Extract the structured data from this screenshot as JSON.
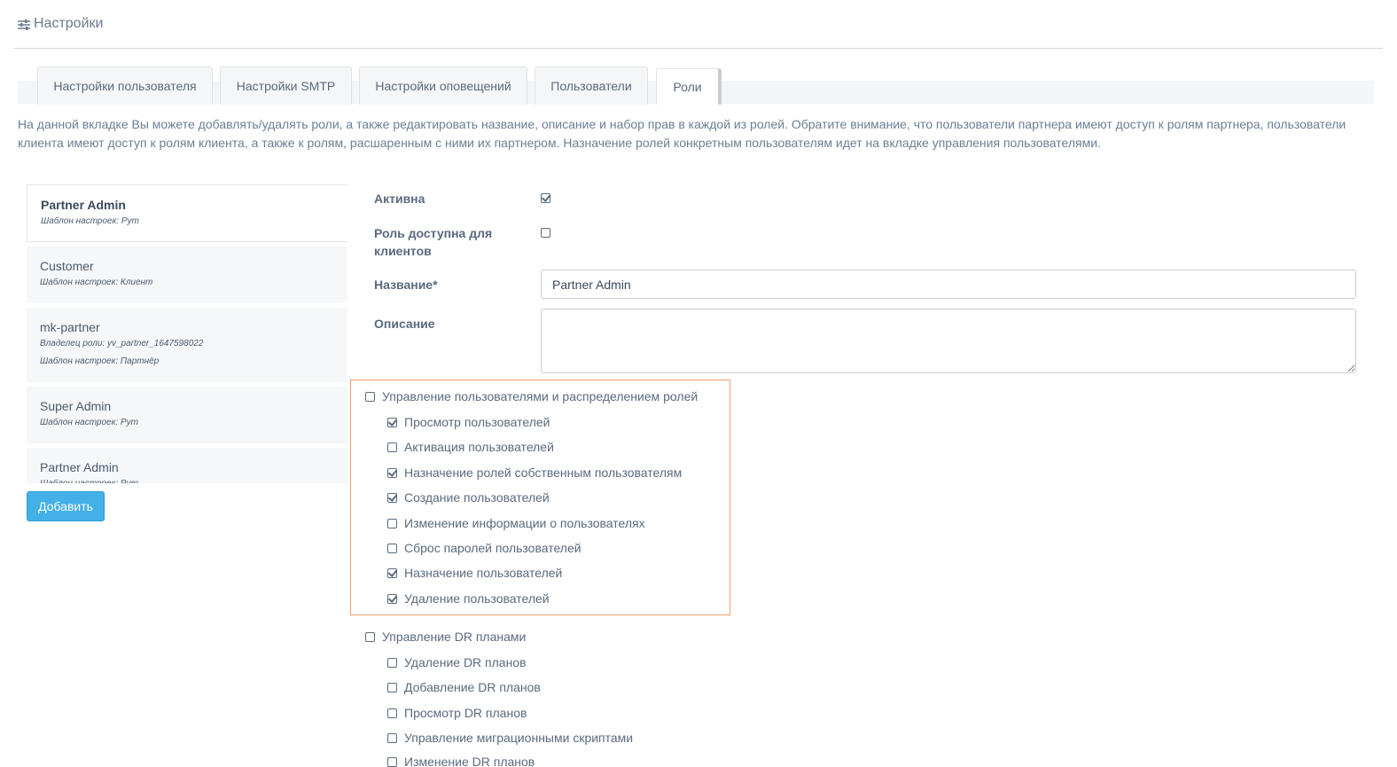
{
  "header": {
    "title": "Настройки",
    "icon": "sliders-icon"
  },
  "tabs": [
    {
      "label": "Настройки пользователя",
      "active": false
    },
    {
      "label": "Настройки SMTP",
      "active": false
    },
    {
      "label": "Настройки оповещений",
      "active": false
    },
    {
      "label": "Пользователи",
      "active": false
    },
    {
      "label": "Роли",
      "active": true
    }
  ],
  "description": "На данной вкладке Вы можете добавлять/удалять роли, а также редактировать название, описание и набор прав в каждой из ролей. Обратите внимание, что пользователи партнера имеют доступ к ролям партнера, пользователи клиента имеют доступ к ролям клиента, а также к ролям, расшаренным с ними их партнером. Назначение ролей конкретным пользователям идет на вкладке управления пользователями.",
  "roles": [
    {
      "name": "Partner Admin",
      "meta": [
        "Шаблон настроек: Рут"
      ],
      "active": true
    },
    {
      "name": "Customer",
      "meta": [
        "Шаблон настроек: Клиент"
      ],
      "active": false
    },
    {
      "name": "mk-partner",
      "meta": [
        "Владелец роли: yv_partner_1647598022",
        "Шаблон настроек: Партнёр"
      ],
      "active": false
    },
    {
      "name": "Super Admin",
      "meta": [
        "Шаблон настроек: Рут"
      ],
      "active": false
    },
    {
      "name": "Partner Admin",
      "meta": [
        "Шаблон настроек: Рут"
      ],
      "active": false
    }
  ],
  "add_button_label": "Добавить",
  "form": {
    "active_label": "Активна",
    "active_checked": true,
    "client_access_label": "Роль доступна для клиентов",
    "client_access_checked": false,
    "name_label": "Название*",
    "name_value": "Partner Admin",
    "description_label": "Описание",
    "description_value": ""
  },
  "permissions": [
    {
      "label": "Управление пользователями и распределением ролей",
      "checked": false,
      "children": [
        {
          "label": "Просмотр пользователей",
          "checked": true
        },
        {
          "label": "Активация пользователей",
          "checked": false
        },
        {
          "label": "Назначение ролей собственным пользователям",
          "checked": true
        },
        {
          "label": "Создание пользователей",
          "checked": true
        },
        {
          "label": "Изменение информации о пользователях",
          "checked": false
        },
        {
          "label": "Сброс паролей пользователей",
          "checked": false
        },
        {
          "label": "Назначение пользователей",
          "checked": true
        },
        {
          "label": "Удаление пользователей",
          "checked": true
        }
      ]
    },
    {
      "label": "Управление DR планами",
      "checked": false,
      "children": [
        {
          "label": "Удаление DR планов",
          "checked": false
        },
        {
          "label": "Добавление DR планов",
          "checked": false
        },
        {
          "label": "Просмотр DR планов",
          "checked": false
        },
        {
          "label": "Управление миграционными скриптами",
          "checked": false
        },
        {
          "label": "Изменение DR планов",
          "checked": false
        }
      ]
    }
  ],
  "colors": {
    "accent": "#44b0e8",
    "highlight_border": "#f0a070",
    "text": "#5a6a7e"
  }
}
